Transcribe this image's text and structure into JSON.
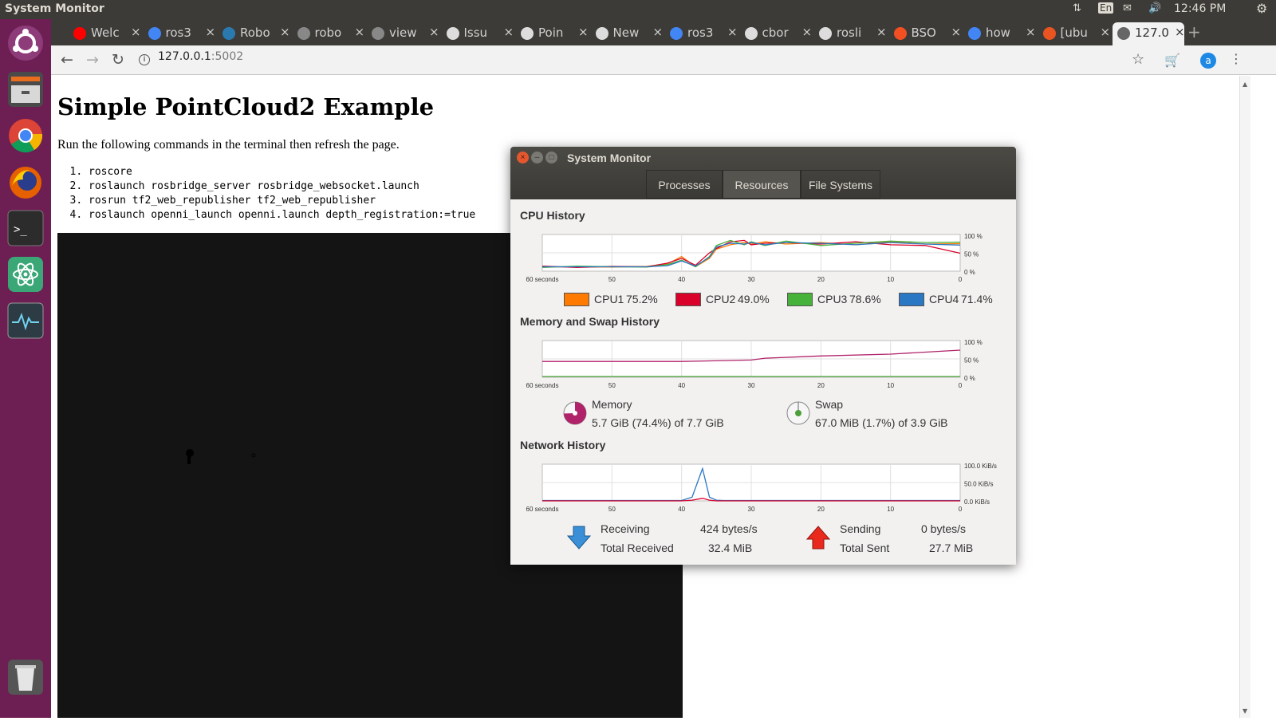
{
  "top_panel": {
    "app_name": "System Monitor",
    "keyboard": "En",
    "time": "12:46 PM"
  },
  "browser": {
    "tabs": [
      {
        "title": "Welc",
        "icon": "youtube-icon",
        "color": "#ff0000"
      },
      {
        "title": "ros3",
        "icon": "google-icon",
        "color": "#4285f4"
      },
      {
        "title": "Robo",
        "icon": "robowebtools-icon",
        "color": "#2a7ab0"
      },
      {
        "title": "robo",
        "icon": "page-icon",
        "color": "#888888"
      },
      {
        "title": "view",
        "icon": "page-icon",
        "color": "#888888"
      },
      {
        "title": "Issu",
        "icon": "github-icon",
        "color": "#dddddd"
      },
      {
        "title": "Poin",
        "icon": "github-icon",
        "color": "#dddddd"
      },
      {
        "title": "New",
        "icon": "github-icon",
        "color": "#dddddd"
      },
      {
        "title": "ros3",
        "icon": "google-icon",
        "color": "#4285f4"
      },
      {
        "title": "cbor",
        "icon": "github-icon",
        "color": "#dddddd"
      },
      {
        "title": "rosli",
        "icon": "github-icon",
        "color": "#dddddd"
      },
      {
        "title": "BSO",
        "icon": "microsoft-icon",
        "color": "#f25022"
      },
      {
        "title": "how",
        "icon": "google-icon",
        "color": "#4285f4"
      },
      {
        "title": "[ubu",
        "icon": "ubuntu-icon",
        "color": "#e95420"
      },
      {
        "title": "127.0",
        "icon": "page-icon",
        "color": "#666666"
      }
    ],
    "url_host": "127.0.0.1",
    "url_port": ":5002",
    "profile_initial": "a"
  },
  "page": {
    "title": "Simple PointCloud2 Example",
    "intro": "Run the following commands in the terminal then refresh the page.",
    "commands": [
      "roscore",
      "roslaunch rosbridge_server rosbridge_websocket.launch",
      "rosrun tf2_web_republisher tf2_web_republisher",
      "roslaunch openni_launch openni.launch depth_registration:=true"
    ]
  },
  "sysmon": {
    "window_title": "System Monitor",
    "tabs": [
      "Processes",
      "Resources",
      "File Systems"
    ],
    "cpu": {
      "heading": "CPU History",
      "y_ticks": [
        "100 %",
        "50 %",
        "0 %"
      ],
      "x_ticks": [
        "60 seconds",
        "50",
        "40",
        "30",
        "20",
        "10",
        "0"
      ],
      "legend": [
        {
          "name": "CPU1",
          "value": "75.2%",
          "color": "#ff7a00"
        },
        {
          "name": "CPU2",
          "value": "49.0%",
          "color": "#d9002a"
        },
        {
          "name": "CPU3",
          "value": "78.6%",
          "color": "#46b23a"
        },
        {
          "name": "CPU4",
          "value": "71.4%",
          "color": "#2a78c4"
        }
      ]
    },
    "mem": {
      "heading": "Memory and Swap History",
      "y_ticks": [
        "100 %",
        "50 %",
        "0 %"
      ],
      "x_ticks": [
        "60 seconds",
        "50",
        "40",
        "30",
        "20",
        "10",
        "0"
      ],
      "memory_label": "Memory",
      "memory_value": "5.7 GiB (74.4%) of 7.7 GiB",
      "memory_fraction": 0.744,
      "memory_color": "#b0226a",
      "swap_label": "Swap",
      "swap_value": "67.0 MiB (1.7%) of 3.9 GiB",
      "swap_fraction": 0.017,
      "swap_color": "#4aa03a"
    },
    "net": {
      "heading": "Network History",
      "y_ticks": [
        "100.0 KiB/s",
        "50.0 KiB/s",
        "0.0 KiB/s"
      ],
      "x_ticks": [
        "60 seconds",
        "50",
        "40",
        "30",
        "20",
        "10",
        "0"
      ],
      "receiving_label": "Receiving",
      "receiving_value": "424 bytes/s",
      "total_received_label": "Total Received",
      "total_received_value": "32.4 MiB",
      "sending_label": "Sending",
      "sending_value": "0 bytes/s",
      "total_sent_label": "Total Sent",
      "total_sent_value": "27.7 MiB",
      "recv_color": "#2a78c4",
      "send_color": "#d9002a"
    }
  },
  "chart_data": [
    {
      "type": "line",
      "x_range": [
        60,
        0
      ],
      "ylim": [
        0,
        100
      ],
      "x": [
        60,
        55,
        50,
        45,
        42,
        40,
        38,
        36,
        35,
        33,
        31,
        30,
        28,
        25,
        20,
        15,
        10,
        5,
        0
      ],
      "series": [
        {
          "name": "CPU1",
          "values": [
            12,
            12,
            11,
            13,
            20,
            40,
            12,
            35,
            60,
            72,
            78,
            74,
            80,
            74,
            78,
            72,
            80,
            74,
            75
          ]
        },
        {
          "name": "CPU2",
          "values": [
            14,
            10,
            13,
            12,
            22,
            35,
            16,
            50,
            62,
            80,
            84,
            72,
            76,
            78,
            74,
            80,
            72,
            70,
            49
          ]
        },
        {
          "name": "CPU3",
          "values": [
            10,
            14,
            12,
            11,
            18,
            30,
            12,
            40,
            70,
            84,
            72,
            80,
            70,
            82,
            70,
            76,
            82,
            78,
            79
          ]
        },
        {
          "name": "CPU4",
          "values": [
            12,
            12,
            12,
            12,
            15,
            28,
            14,
            38,
            66,
            76,
            74,
            78,
            72,
            78,
            76,
            72,
            78,
            74,
            71
          ]
        }
      ]
    },
    {
      "type": "line",
      "x_range": [
        60,
        0
      ],
      "ylim": [
        0,
        100
      ],
      "x": [
        60,
        40,
        30,
        28,
        20,
        10,
        0
      ],
      "series": [
        {
          "name": "Memory",
          "values": [
            43,
            43,
            47,
            52,
            58,
            63,
            74
          ]
        },
        {
          "name": "Swap",
          "values": [
            2,
            2,
            2,
            2,
            2,
            2,
            2
          ]
        }
      ]
    },
    {
      "type": "line",
      "x_range": [
        60,
        0
      ],
      "ylim": [
        0,
        100
      ],
      "x": [
        60,
        40,
        38.5,
        37,
        36,
        35,
        34,
        33,
        20,
        0
      ],
      "series": [
        {
          "name": "Receiving",
          "values": [
            1,
            1,
            10,
            88,
            10,
            2,
            1,
            1,
            1,
            1
          ]
        },
        {
          "name": "Sending",
          "values": [
            0,
            0,
            2,
            7,
            2,
            0,
            0,
            0,
            0,
            0
          ]
        }
      ]
    }
  ]
}
